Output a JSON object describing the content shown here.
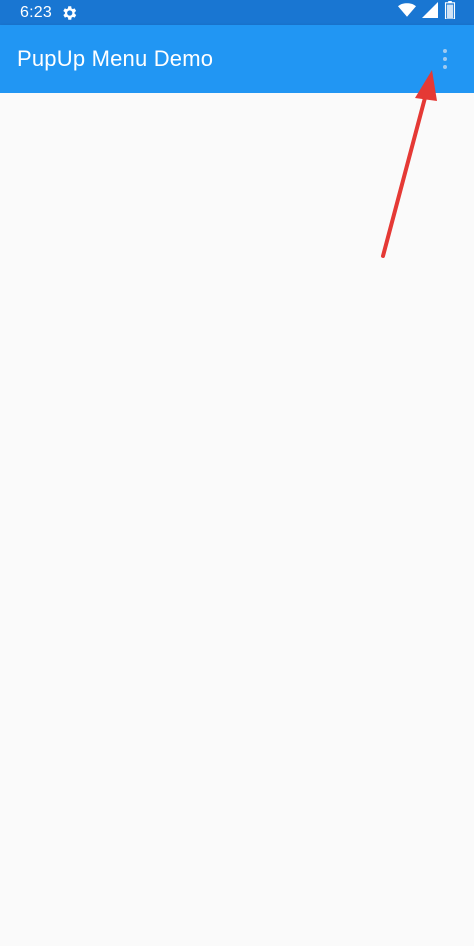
{
  "status_bar": {
    "time": "6:23",
    "icons": [
      "gear-icon",
      "wifi-icon",
      "signal-icon",
      "battery-icon"
    ]
  },
  "app_bar": {
    "title": "PupUp Menu Demo",
    "overflow_icon": "more-vert-icon"
  },
  "annotation": {
    "arrow_icon": "red-arrow",
    "arrow_color": "#e53935"
  },
  "colors": {
    "status_bar": "#1976d2",
    "app_bar": "#2196f3",
    "background": "#fafafa"
  }
}
